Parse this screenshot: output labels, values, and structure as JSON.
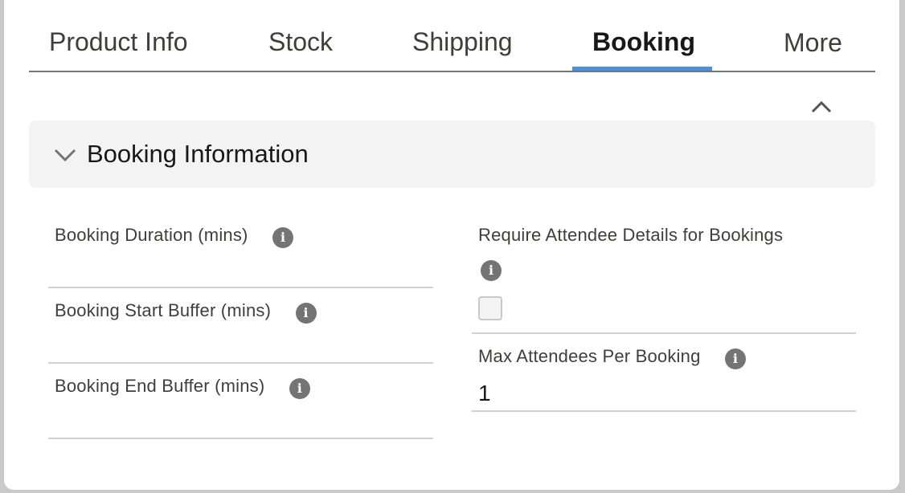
{
  "tabs": [
    {
      "label": "Product Info",
      "active": false
    },
    {
      "label": "Stock",
      "active": false
    },
    {
      "label": "Shipping",
      "active": false
    },
    {
      "label": "Booking",
      "active": true
    },
    {
      "label": "More",
      "active": false
    }
  ],
  "section": {
    "title": "Booking Information",
    "expanded": true
  },
  "fields": {
    "booking_duration": {
      "label": "Booking Duration (mins)",
      "value": ""
    },
    "booking_start_buffer": {
      "label": "Booking Start Buffer (mins)",
      "value": ""
    },
    "booking_end_buffer": {
      "label": "Booking End Buffer (mins)",
      "value": ""
    },
    "require_attendee_details": {
      "label": "Require Attendee Details for Bookings",
      "checked": false
    },
    "max_attendees": {
      "label": "Max Attendees Per Booking",
      "value": "1"
    }
  },
  "icons": {
    "info": "info-icon",
    "collapse": "chevron-up-icon",
    "section_toggle": "chevron-down-icon"
  },
  "colors": {
    "active_tab_underline": "#4a90e2",
    "section_header_bg": "#f3f3f3",
    "info_icon_bg": "#747474"
  }
}
